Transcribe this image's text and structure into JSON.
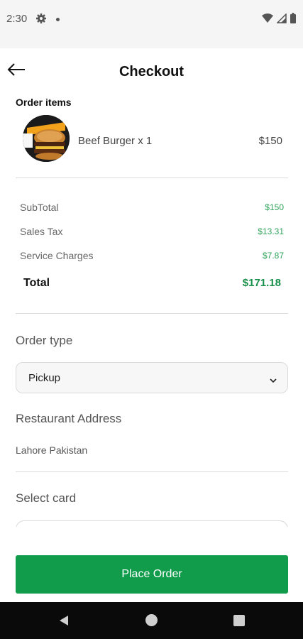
{
  "status_bar": {
    "time": "2:30"
  },
  "header": {
    "title": "Checkout"
  },
  "order_items": {
    "label": "Order items",
    "items": [
      {
        "name": "Beef Burger x 1",
        "price": "$150"
      }
    ]
  },
  "summary": {
    "subtotal_label": "SubTotal",
    "subtotal_value": "$150",
    "tax_label": "Sales Tax",
    "tax_value": "$13.31",
    "service_label": "Service Charges",
    "service_value": "$7.87",
    "total_label": "Total",
    "total_value": "$171.18"
  },
  "order_type": {
    "heading": "Order type",
    "selected": "Pickup"
  },
  "restaurant": {
    "heading": "Restaurant Address",
    "address": "Lahore Pakistan"
  },
  "card": {
    "heading": "Select card"
  },
  "actions": {
    "place_order": "Place Order"
  },
  "colors": {
    "accent": "#119c4c",
    "price_green": "#2ea35b"
  }
}
